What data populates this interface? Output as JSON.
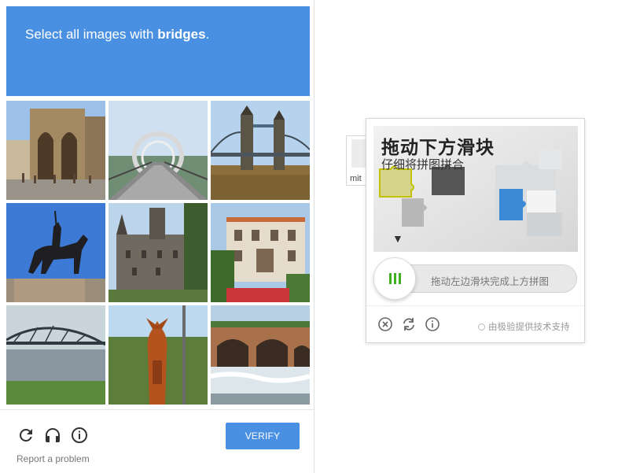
{
  "recaptcha": {
    "instruction_prefix": "Select all images with ",
    "instruction_target": "bridges",
    "instruction_suffix": ".",
    "verify_label": "VERIFY",
    "report_link": "Report a problem",
    "tiles": [
      "cathedral",
      "covered-footbridge",
      "tower-bridge",
      "equestrian-statue",
      "castle",
      "villa",
      "truss-bridge",
      "wooden-totem",
      "stone-arch-bridge"
    ],
    "icons": [
      "reload-icon",
      "audio-icon",
      "info-icon"
    ],
    "accent_color": "#4a90e2"
  },
  "background_fragment": {
    "label": "mit"
  },
  "geetest": {
    "title": "拖动下方滑块",
    "subtitle": "仔细将拼图拼合",
    "slider_hint": "拖动左边滑块完成上方拼图",
    "brand": "由极验提供技术支持",
    "icons": [
      "close-icon",
      "refresh-icon",
      "info-icon"
    ],
    "knob_color": "#3fae1f"
  }
}
